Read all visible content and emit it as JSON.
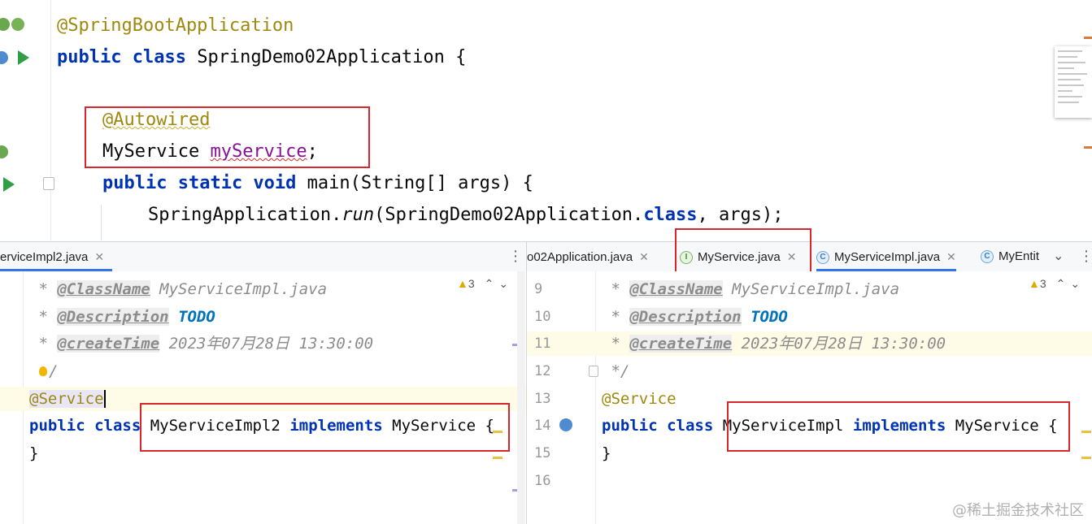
{
  "top_editor": {
    "lines": {
      "annotation": "@SpringBootApplication",
      "class_kw": "public class",
      "class_rest": " SpringDemo02Application {",
      "autowired": "@Autowired",
      "field_type": "MyService ",
      "field_name": "myService",
      "field_end": ";",
      "main_kw": "public static void",
      "main_rest": " main(String[] args) {",
      "run_obj": "SpringApplication.",
      "run_method": "run",
      "run_args_a": "(SpringDemo02Application.",
      "run_class_kw": "class",
      "run_args_b": ", args);"
    }
  },
  "left_pane": {
    "tab_label": "erviceImpl2.java",
    "warnings": "3",
    "lines": {
      "doc_star": " * ",
      "classname_tag": "@ClassName",
      "classname_val": " MyServiceImpl.java",
      "desc_tag": "@Description",
      "todo": "TODO",
      "createtime_tag": "@createTime",
      "createtime_val": " 2023年07月28日 13:30:00",
      "doc_end": "/",
      "service_ann": "@Service",
      "class_kw": "public class",
      "class_rest": " MyServiceImpl2 ",
      "implements_kw": "implements",
      "iface": " MyService {",
      "close": "}"
    }
  },
  "right_pane": {
    "tabs": [
      {
        "label": "o02Application.java"
      },
      {
        "label": "MyService.java",
        "icon": "I"
      },
      {
        "label": "MyServiceImpl.java",
        "icon": "C"
      },
      {
        "label": "MyEntit",
        "icon": "C"
      }
    ],
    "warnings": "3",
    "line_numbers": [
      "9",
      "10",
      "11",
      "12",
      "13",
      "14",
      "15",
      "16"
    ],
    "lines": {
      "doc_star": " * ",
      "classname_tag": "@ClassName",
      "classname_val": " MyServiceImpl.java",
      "desc_tag": "@Description",
      "todo": "TODO",
      "createtime_tag": "@createTime",
      "createtime_val": " 2023年07月28日 13:30:00",
      "doc_end": " */",
      "service_ann": "@Service",
      "class_kw": "public class",
      "class_rest": " MyServiceImpl ",
      "implements_kw": "implements",
      "iface": " MyService {",
      "close": "}"
    }
  },
  "watermark": "@稀土掘金技术社区",
  "colors": {
    "highlight_box": "#d9262c",
    "keyword": "#0033b3",
    "annotation": "#9e880d",
    "field": "#871094"
  }
}
